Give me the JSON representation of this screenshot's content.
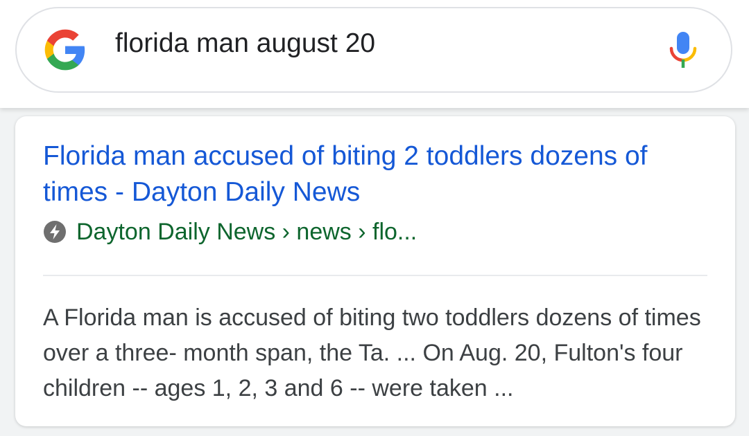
{
  "search": {
    "query": "florida man august 20"
  },
  "colors": {
    "title_link": "#1558d6",
    "breadcrumb": "#0d652d",
    "snippet_text": "#3c4043",
    "google_blue": "#4285f4",
    "google_red": "#ea4335",
    "google_yellow": "#fbbc05",
    "google_green": "#34a853"
  },
  "icons": {
    "logo": "google-g-logo",
    "voice": "microphone-icon",
    "amp": "lightning-bolt-icon"
  },
  "result": {
    "title": "Florida man accused of biting 2 toddlers dozens of times - Dayton Daily News",
    "breadcrumb": "Dayton Daily News › news › flo...",
    "snippet": "A Florida man is accused of biting two toddlers dozens of times over a three- month span, the Ta. ... On Aug. 20, Fulton's four children -- ages 1, 2, 3 and 6 -- were taken ..."
  }
}
